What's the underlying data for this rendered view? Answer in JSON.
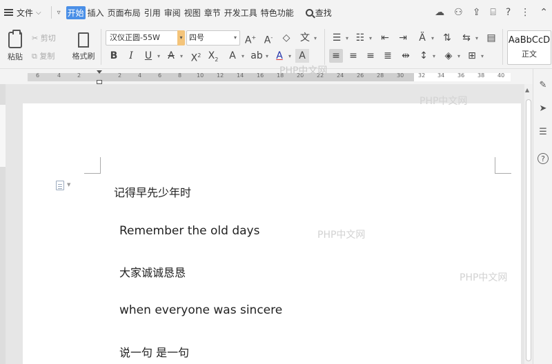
{
  "menu": {
    "file_label": "文件",
    "tabs": [
      "开始",
      "插入",
      "页面布局",
      "引用",
      "审阅",
      "视图",
      "章节",
      "开发工具",
      "特色功能"
    ],
    "active_tab": "开始",
    "search_label": "查找"
  },
  "ribbon": {
    "paste_label": "粘贴",
    "cut_label": "剪切",
    "copy_label": "复制",
    "format_painter_label": "格式刷",
    "font_name": "汉仪正圆-55W",
    "font_size": "四号",
    "style_sample": "AaBbCcD",
    "style_name": "正文"
  },
  "ruler": {
    "ticks": [
      "6",
      "4",
      "2",
      "2",
      "4",
      "6",
      "8",
      "10",
      "12",
      "14",
      "16",
      "18",
      "20",
      "22",
      "24",
      "26",
      "28",
      "30",
      "32",
      "34",
      "36",
      "38",
      "40"
    ]
  },
  "document": {
    "lines": [
      "记得早先少年时",
      "Remember the old days",
      "大家诚诚恳恳",
      "when everyone was sincere",
      "说一句  是一句"
    ]
  },
  "watermarks": [
    "PHP中文网",
    "PHP中文网",
    "PHP中文网",
    "PHP中文网"
  ]
}
